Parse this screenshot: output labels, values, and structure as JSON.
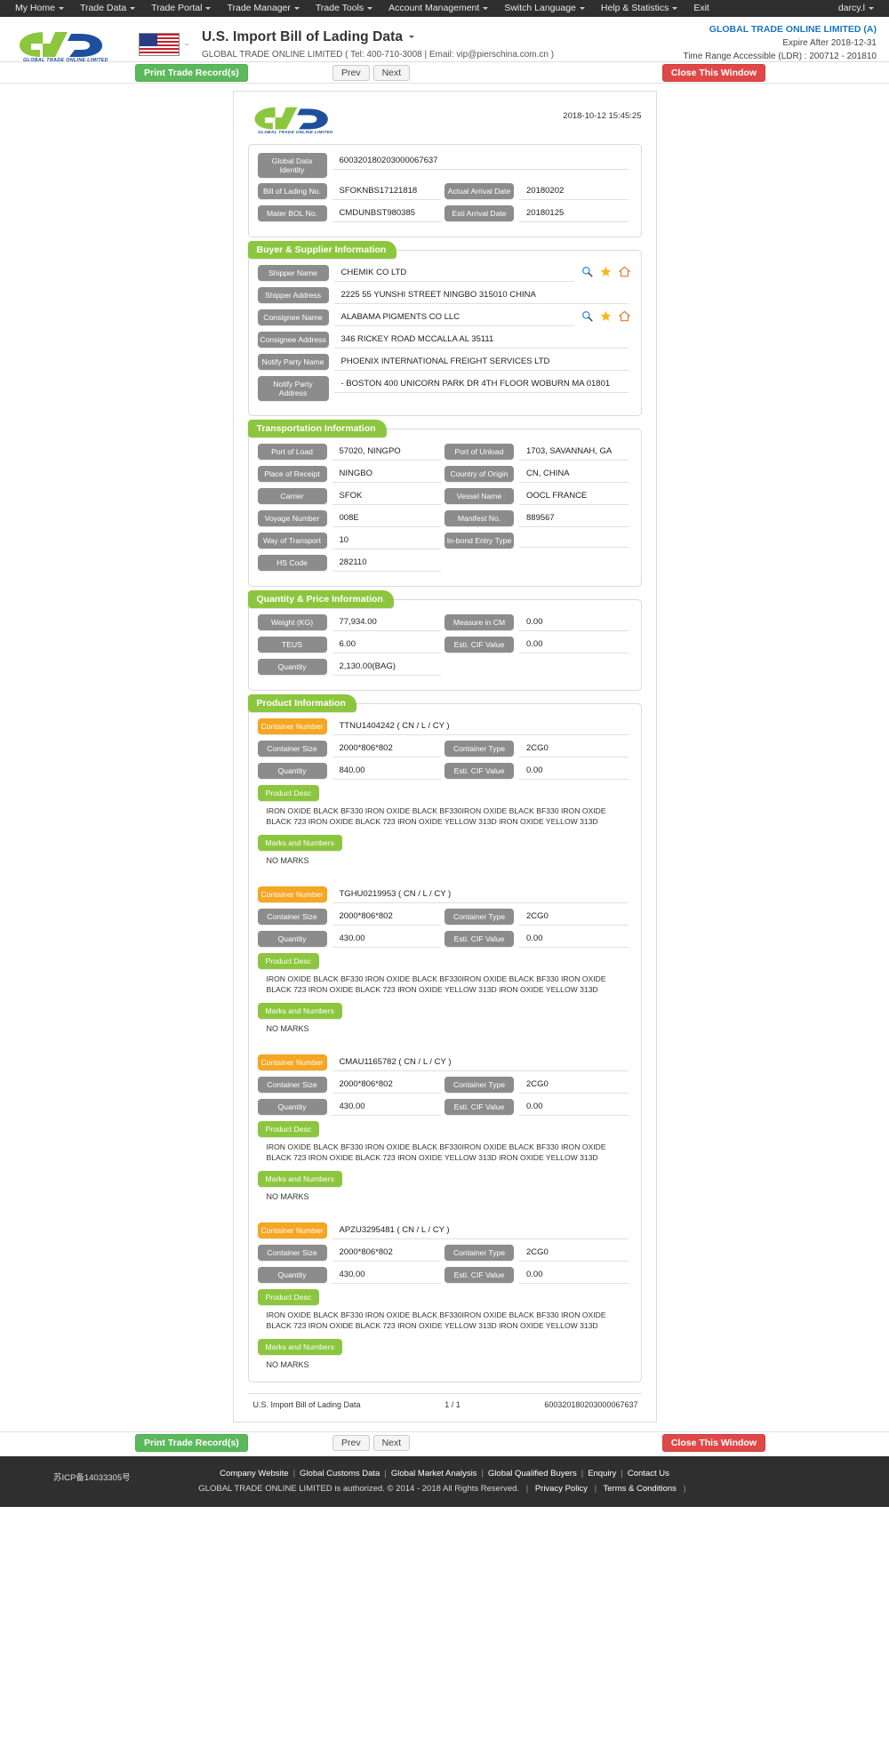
{
  "topnav": {
    "items": [
      {
        "label": "My Home",
        "caret": true
      },
      {
        "label": "Trade Data",
        "caret": true
      },
      {
        "label": "Trade Portal",
        "caret": true
      },
      {
        "label": "Trade Manager",
        "caret": true
      },
      {
        "label": "Trade Tools",
        "caret": true
      },
      {
        "label": "Account Management",
        "caret": true
      },
      {
        "label": "Switch Language",
        "caret": true
      },
      {
        "label": "Help & Statistics",
        "caret": true
      },
      {
        "label": "Exit",
        "caret": false
      }
    ],
    "user": "darcy.l"
  },
  "brand": {
    "logo_text": "GLOBAL TRADE ONLINE LIMITED",
    "flag": "us-flag-icon",
    "title": "U.S. Import Bill of Lading Data",
    "subtitle": "GLOBAL TRADE ONLINE LIMITED ( Tel: 400-710-3008 | Email: vip@pierschina.com.cn )",
    "account_name": "GLOBAL TRADE ONLINE LIMITED (A)",
    "expire": "Expire After 2018-12-31",
    "time_range": "Time Range Accessible (LDR) : 200712 - 201810"
  },
  "toolbar": {
    "print_label": "Print Trade Record(s)",
    "prev_label": "Prev",
    "next_label": "Next",
    "close_label": "Close This Window"
  },
  "paper": {
    "date": "2018-10-12 15:45:25",
    "identity": {
      "label": "Global Data Identity",
      "value": "600320180203000067637"
    },
    "rows": [
      {
        "label": "Bill of Lading No.",
        "value": "SFOKNBS17121818",
        "label2": "Actual Arrival Date",
        "value2": "20180202"
      },
      {
        "label": "Mater BOL No.",
        "value": "CMDUNBST980385",
        "label2": "Esti Arrival Date",
        "value2": "20180125"
      }
    ],
    "buyer_supplier": {
      "title": "Buyer & Supplier Information",
      "fields": [
        {
          "label": "Shipper Name",
          "value": "CHEMIK CO LTD",
          "icons": true
        },
        {
          "label": "Shipper Address",
          "value": "2225 55 YUNSHI STREET NINGBO 315010 CHINA",
          "icons": false
        },
        {
          "label": "Consignee Name",
          "value": "ALABAMA PIGMENTS CO LLC",
          "icons": true
        },
        {
          "label": "Consignee Address",
          "value": "346 RICKEY ROAD MCCALLA AL 35111",
          "icons": false
        },
        {
          "label": "Notify Party Name",
          "value": "PHOENIX INTERNATIONAL FREIGHT SERVICES LTD",
          "icons": false
        },
        {
          "label": "Notify Party Address",
          "value": "- BOSTON 400 UNICORN PARK DR 4TH FLOOR WOBURN MA 01801",
          "icons": false
        }
      ]
    },
    "transportation": {
      "title": "Transportation Information",
      "rows": [
        {
          "label": "Port of Load",
          "value": "57020, NINGPO",
          "label2": "Port of Unload",
          "value2": "1703, SAVANNAH, GA"
        },
        {
          "label": "Place of Receipt",
          "value": "NINGBO",
          "label2": "Country of Origin",
          "value2": "CN, CHINA"
        },
        {
          "label": "Carrier",
          "value": "SFOK",
          "label2": "Vessel Name",
          "value2": "OOCL FRANCE"
        },
        {
          "label": "Voyage Number",
          "value": "008E",
          "label2": "Manifest No.",
          "value2": "889567"
        },
        {
          "label": "Way of Transport",
          "value": "10",
          "label2": "In-bond Entry Type",
          "value2": ""
        },
        {
          "label": "HS Code",
          "value": "282110",
          "label2": "",
          "value2": ""
        }
      ]
    },
    "quantity_price": {
      "title": "Quantity & Price Information",
      "rows": [
        {
          "label": "Weight (KG)",
          "value": "77,934.00",
          "label2": "Measure in CM",
          "value2": "0.00"
        },
        {
          "label": "TEUS",
          "value": "6.00",
          "label2": "Esti. CIF Value",
          "value2": "0.00"
        },
        {
          "label": "Quantity",
          "value": "2,130.00(BAG)",
          "label2": "",
          "value2": ""
        }
      ]
    },
    "product": {
      "title": "Product Information",
      "labels": {
        "container_number": "Container Number",
        "container_size": "Container Size",
        "container_type": "Container Type",
        "quantity": "Quantity",
        "cif": "Esti. CIF Value",
        "product_desc": "Product Desc",
        "marks": "Marks and Numbers"
      },
      "containers": [
        {
          "number": "TTNU1404242 ( CN / L / CY )",
          "size": "2000*806*802",
          "type": "2CG0",
          "quantity": "840.00",
          "cif": "0.00",
          "desc": "IRON OXIDE BLACK BF330 IRON OXIDE BLACK BF330IRON OXIDE BLACK BF330 IRON OXIDE BLACK 723 IRON OXIDE BLACK 723 IRON OXIDE YELLOW 313D IRON OXIDE YELLOW 313D",
          "marks": "NO MARKS"
        },
        {
          "number": "TGHU0219953 ( CN / L / CY )",
          "size": "2000*806*802",
          "type": "2CG0",
          "quantity": "430.00",
          "cif": "0.00",
          "desc": "IRON OXIDE BLACK BF330 IRON OXIDE BLACK BF330IRON OXIDE BLACK BF330 IRON OXIDE BLACK 723 IRON OXIDE BLACK 723 IRON OXIDE YELLOW 313D IRON OXIDE YELLOW 313D",
          "marks": "NO MARKS"
        },
        {
          "number": "CMAU1165782 ( CN / L / CY )",
          "size": "2000*806*802",
          "type": "2CG0",
          "quantity": "430.00",
          "cif": "0.00",
          "desc": "IRON OXIDE BLACK BF330 IRON OXIDE BLACK BF330IRON OXIDE BLACK BF330 IRON OXIDE BLACK 723 IRON OXIDE BLACK 723 IRON OXIDE YELLOW 313D IRON OXIDE YELLOW 313D",
          "marks": "NO MARKS"
        },
        {
          "number": "APZU3295481 ( CN / L / CY )",
          "size": "2000*806*802",
          "type": "2CG0",
          "quantity": "430.00",
          "cif": "0.00",
          "desc": "IRON OXIDE BLACK BF330 IRON OXIDE BLACK BF330IRON OXIDE BLACK BF330 IRON OXIDE BLACK 723 IRON OXIDE BLACK 723 IRON OXIDE YELLOW 313D IRON OXIDE YELLOW 313D",
          "marks": "NO MARKS"
        }
      ]
    },
    "footer": {
      "left": "U.S. Import Bill of Lading Data",
      "center": "1 / 1",
      "right": "600320180203000067637"
    }
  },
  "footer": {
    "icp": "苏ICP备14033305号",
    "links": [
      "Company Website",
      "Global Customs Data",
      "Global Market Analysis",
      "Global Qualified Buyers",
      "Enquiry",
      "Contact Us"
    ],
    "copyright": "GLOBAL TRADE ONLINE LIMITED is authorized. © 2014 - 2018 All Rights Reserved.",
    "privacy": "Privacy Policy",
    "terms": "Terms & Conditions"
  },
  "colors": {
    "green": "#8cc63e",
    "orange": "#f5a623",
    "gray_label": "#8c8c8c",
    "accent_blue": "#1a75c2",
    "btn_green": "#5cb85c",
    "btn_red": "#e04848",
    "nav_dark": "#2f2f2f"
  }
}
